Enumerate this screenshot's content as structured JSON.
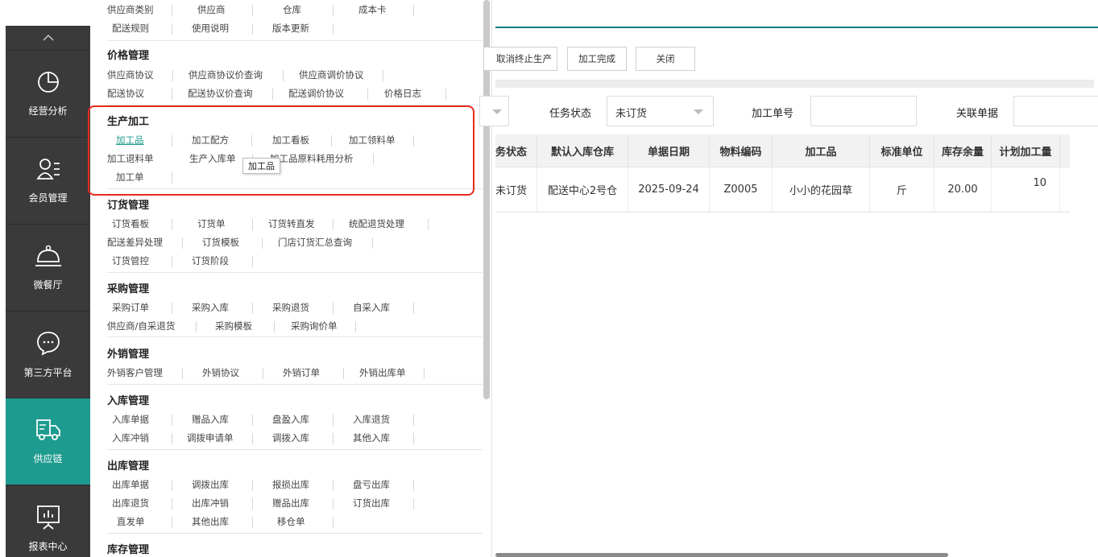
{
  "sidebar": {
    "items": [
      {
        "label": "经营分析",
        "icon": "pie-chart-icon"
      },
      {
        "label": "会员管理",
        "icon": "member-icon"
      },
      {
        "label": "微餐厅",
        "icon": "cloche-icon"
      },
      {
        "label": "第三方平台",
        "icon": "chat-bubble-icon"
      },
      {
        "label": "供应链",
        "icon": "delivery-truck-icon"
      },
      {
        "label": "报表中心",
        "icon": "report-board-icon"
      }
    ]
  },
  "menu": {
    "top_rows": [
      [
        "供应商类别",
        "供应商",
        "仓库",
        "成本卡"
      ],
      [
        "配送规则",
        "使用说明",
        "版本更新"
      ]
    ],
    "groups": [
      {
        "title": "价格管理",
        "rows": [
          [
            "供应商协议",
            "供应商协议价查询",
            "供应商调价协议"
          ],
          [
            "配送协议",
            "配送协议价查询",
            "配送调价协议",
            "价格日志"
          ]
        ]
      },
      {
        "title": "生产加工",
        "rows": [
          [
            "加工品",
            "加工配方",
            "加工看板",
            "加工领料单"
          ],
          [
            "加工退料单",
            "生产入库单",
            "加工品原料耗用分析"
          ],
          [
            "加工单"
          ]
        ]
      },
      {
        "title": "订货管理",
        "rows": [
          [
            "订货看板",
            "订货单",
            "订货转直发",
            "统配退货处理"
          ],
          [
            "配送差异处理",
            "订货模板",
            "门店订货汇总查询"
          ],
          [
            "订货管控",
            "订货阶段"
          ]
        ]
      },
      {
        "title": "采购管理",
        "rows": [
          [
            "采购订单",
            "采购入库",
            "采购退货",
            "自采入库"
          ],
          [
            "供应商/自采退货",
            "采购模板",
            "采购询价单"
          ]
        ]
      },
      {
        "title": "外销管理",
        "rows": [
          [
            "外销客户管理",
            "外销协议",
            "外销订单",
            "外销出库单"
          ]
        ]
      },
      {
        "title": "入库管理",
        "rows": [
          [
            "入库单据",
            "赠品入库",
            "盘盈入库",
            "入库退货"
          ],
          [
            "入库冲销",
            "调拨申请单",
            "调拨入库",
            "其他入库"
          ]
        ]
      },
      {
        "title": "出库管理",
        "rows": [
          [
            "出库单据",
            "调拨出库",
            "报损出库",
            "盘亏出库"
          ],
          [
            "出库退货",
            "出库冲销",
            "赠品出库",
            "订货出库"
          ],
          [
            "直发单",
            "其他出库",
            "移仓单"
          ]
        ]
      },
      {
        "title": "库存管理",
        "rows": []
      }
    ],
    "tooltip": "加工品"
  },
  "toolbar": {
    "buttons": [
      "取消终止生产",
      "加工完成",
      "关闭"
    ]
  },
  "filters": {
    "task_status_label": "任务状态",
    "task_status_value": "未订货",
    "process_no_label": "加工单号",
    "related_doc_label": "关联单据"
  },
  "table": {
    "headers": [
      "务状态",
      "默认入库仓库",
      "单据日期",
      "物料编码",
      "加工品",
      "标准单位",
      "库存余量",
      "计划加工量"
    ],
    "rows": [
      [
        "未订货",
        "配送中心2号仓",
        "2025-09-24",
        "Z0005",
        "小小的花园草",
        "斤",
        "20.00",
        "10"
      ]
    ]
  },
  "colors": {
    "sidebar_bg": "#3a3a3a",
    "accent": "#1e9b8f",
    "highlight": "#e62b1f"
  }
}
